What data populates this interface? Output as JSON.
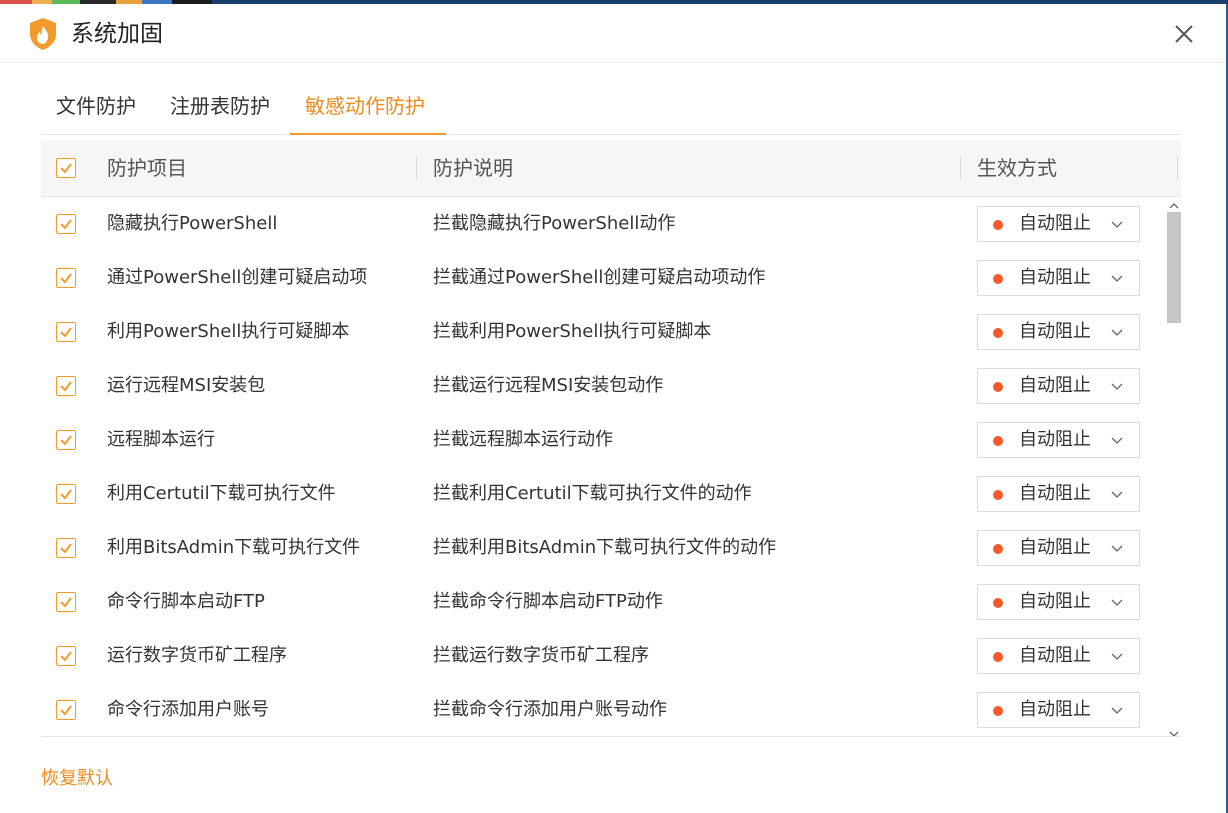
{
  "window": {
    "title": "系统加固"
  },
  "tabs": [
    {
      "label": "文件防护"
    },
    {
      "label": "注册表防护"
    },
    {
      "label": "敏感动作防护"
    }
  ],
  "active_tab": "敏感动作防护",
  "table": {
    "headers": {
      "item": "防护项目",
      "description": "防护说明",
      "mode": "生效方式"
    },
    "select_all_checked": true,
    "rows": [
      {
        "item": "隐藏执行PowerShell",
        "description": "拦截隐藏执行PowerShell动作",
        "mode": "自动阻止",
        "checked": true
      },
      {
        "item": "通过PowerShell创建可疑启动项",
        "description": "拦截通过PowerShell创建可疑启动项动作",
        "mode": "自动阻止",
        "checked": true
      },
      {
        "item": "利用PowerShell执行可疑脚本",
        "description": "拦截利用PowerShell执行可疑脚本",
        "mode": "自动阻止",
        "checked": true
      },
      {
        "item": "运行远程MSI安装包",
        "description": "拦截运行远程MSI安装包动作",
        "mode": "自动阻止",
        "checked": true
      },
      {
        "item": "远程脚本运行",
        "description": "拦截远程脚本运行动作",
        "mode": "自动阻止",
        "checked": true
      },
      {
        "item": "利用Certutil下载可执行文件",
        "description": "拦截利用Certutil下载可执行文件的动作",
        "mode": "自动阻止",
        "checked": true
      },
      {
        "item": "利用BitsAdmin下载可执行文件",
        "description": "拦截利用BitsAdmin下载可执行文件的动作",
        "mode": "自动阻止",
        "checked": true
      },
      {
        "item": "命令行脚本启动FTP",
        "description": "拦截命令行脚本启动FTP动作",
        "mode": "自动阻止",
        "checked": true
      },
      {
        "item": "运行数字货币矿工程序",
        "description": "拦截运行数字货币矿工程序",
        "mode": "自动阻止",
        "checked": true
      },
      {
        "item": "命令行添加用户账号",
        "description": "拦截命令行添加用户账号动作",
        "mode": "自动阻止",
        "checked": true
      }
    ]
  },
  "footer": {
    "restore_label": "恢复默认"
  },
  "icons": {
    "logo": "shield-flame-icon",
    "close": "close-icon",
    "checkbox": "checkmark-icon",
    "dropdown": "chevron-down-icon",
    "status": "red-dot-icon"
  },
  "colors": {
    "accent": "#f08a1c",
    "checkbox": "#f29b2e",
    "status_dot": "#f25a2a",
    "header_bg": "#f6f6f6"
  }
}
